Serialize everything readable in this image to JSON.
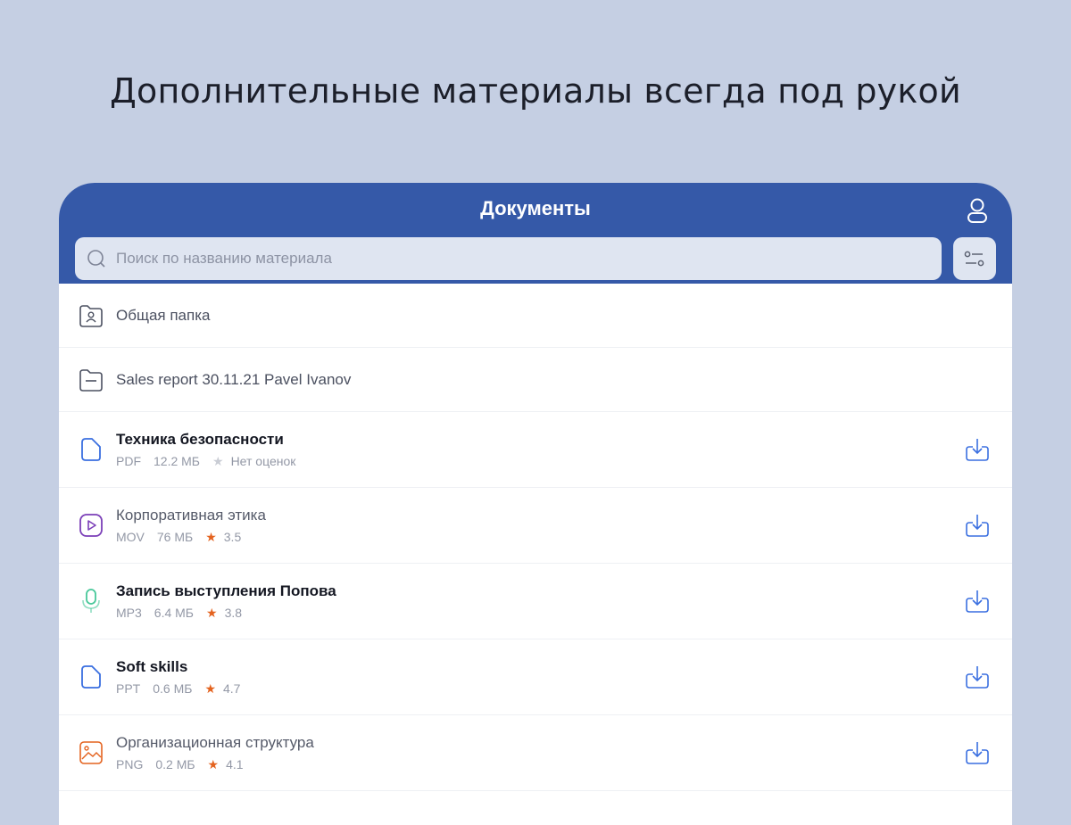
{
  "headline": "Дополнительные материалы всегда под рукой",
  "header": {
    "title": "Документы",
    "profile_icon": "user-icon",
    "filter_icon": "filter-toggle-icon"
  },
  "search": {
    "placeholder": "Поиск по названию материала",
    "value": "",
    "icon": "search-icon"
  },
  "folders": [
    {
      "name": "Общая папка",
      "icon": "shared-folder-icon"
    },
    {
      "name": "Sales report 30.11.21 Pavel Ivanov",
      "icon": "folder-icon"
    }
  ],
  "files": [
    {
      "name": "Техника безопасности",
      "bold": true,
      "type": "PDF",
      "size": "12.2 МБ",
      "rating": "Нет оценок",
      "rated": false,
      "icon": "document-icon",
      "color": "#3a6fe0"
    },
    {
      "name": "Корпоративная этика",
      "bold": false,
      "type": "MOV",
      "size": "76 МБ",
      "rating": "3.5",
      "rated": true,
      "icon": "video-icon",
      "color": "#7b3fb8"
    },
    {
      "name": "Запись выступления Попова",
      "bold": true,
      "type": "MP3",
      "size": "6.4 МБ",
      "rating": "3.8",
      "rated": true,
      "icon": "microphone-icon",
      "color": "#48c89a"
    },
    {
      "name": "Soft skills",
      "bold": true,
      "type": "PPT",
      "size": "0.6 МБ",
      "rating": "4.7",
      "rated": true,
      "icon": "document-icon",
      "color": "#3a6fe0"
    },
    {
      "name": "Организационная структура",
      "bold": false,
      "type": "PNG",
      "size": "0.2 МБ",
      "rating": "4.1",
      "rated": true,
      "icon": "image-icon",
      "color": "#e4631f"
    }
  ],
  "colors": {
    "background": "#c5cfe3",
    "header": "#3559a8",
    "accent": "#3a6fe0",
    "star": "#e4631f"
  },
  "star_glyph": "★"
}
